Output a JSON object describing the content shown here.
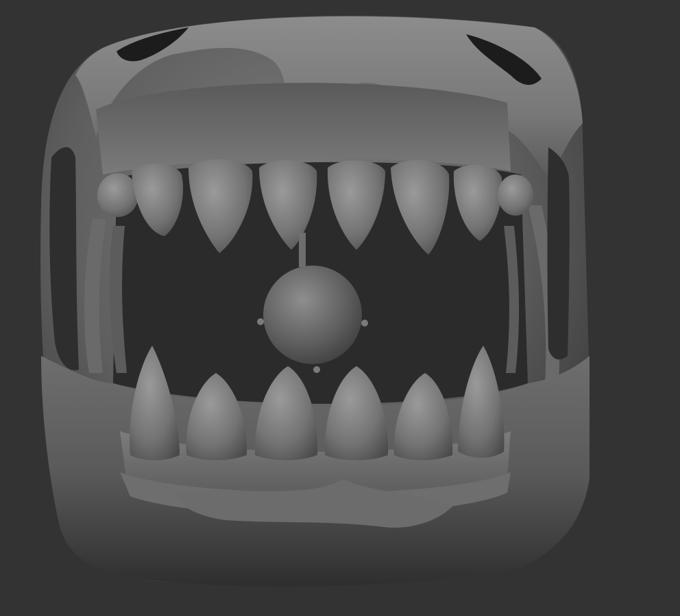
{
  "viewport": {
    "background": "#333333",
    "content": "sculpted-mouth-model"
  },
  "model": {
    "material": "matcap-gray",
    "colors": {
      "shell_light": "#8a8a8a",
      "shell_mid": "#6a6a6a",
      "shell_dark": "#3e3e3e",
      "cavity": "#2a2a2a",
      "gum": "#5e5e5e",
      "tooth": "#7a7a7a",
      "tooth_highlight": "#a2a2a2"
    },
    "upper_teeth_count": 6,
    "lower_teeth_count": 6,
    "tongue_ball": true
  }
}
